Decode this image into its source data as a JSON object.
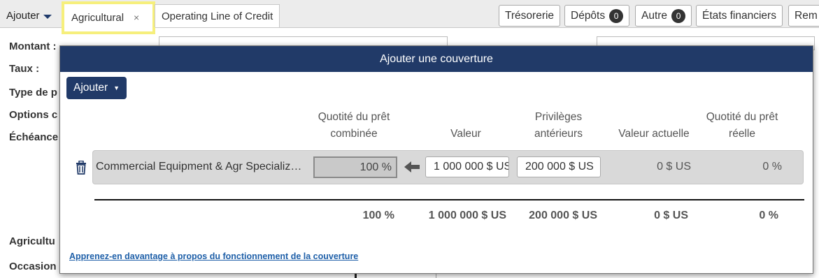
{
  "tabs": {
    "add_label": "Ajouter",
    "active_label": "Agricultural",
    "close_symbol": "×",
    "olc_label": "Operating Line of Credit"
  },
  "right_tabs": {
    "tresorerie": "Trésorerie",
    "depots": "Dépôts",
    "depots_count": "0",
    "autre": "Autre",
    "autre_count": "0",
    "etats": "États financiers",
    "rem": "Rem"
  },
  "background_form": {
    "montant": "Montant :",
    "taux": "Taux :",
    "type": "Type de p",
    "options": "Options c",
    "echeance": "Échéance",
    "agricultu": "Agricultu",
    "occasion": "Occasion"
  },
  "modal": {
    "title": "Ajouter une couverture",
    "add_button": "Ajouter",
    "columns": {
      "ltv_combined_line1": "Quotité du prêt",
      "ltv_combined_line2": "combinée",
      "value": "Valeur",
      "prior_liens_line1": "Privilèges",
      "prior_liens_line2": "antérieurs",
      "current_value": "Valeur actuelle",
      "ltv_actual_line1": "Quotité du prêt",
      "ltv_actual_line2": "réelle"
    },
    "row": {
      "name": "Commercial Equipment & Agr Specializ…",
      "combined_ltv": "100 %",
      "value": "1 000 000 $ US",
      "prior_liens": "200 000 $ US",
      "current_value": "0 $ US",
      "actual_ltv": "0 %"
    },
    "totals": {
      "combined_ltv": "100 %",
      "value": "1 000 000 $ US",
      "prior_liens": "200 000 $ US",
      "current_value": "0 $ US",
      "actual_ltv": "0 %"
    },
    "learn_more": "Apprenez-en davantage à propos du fonctionnement de la couverture"
  },
  "colors": {
    "header": "#213a68",
    "active_tab_highlight": "#f6ef7c",
    "link": "#1e5fa8"
  },
  "icons": [
    "chevron-down-icon",
    "close-icon",
    "trash-icon",
    "arrow-left-icon"
  ]
}
